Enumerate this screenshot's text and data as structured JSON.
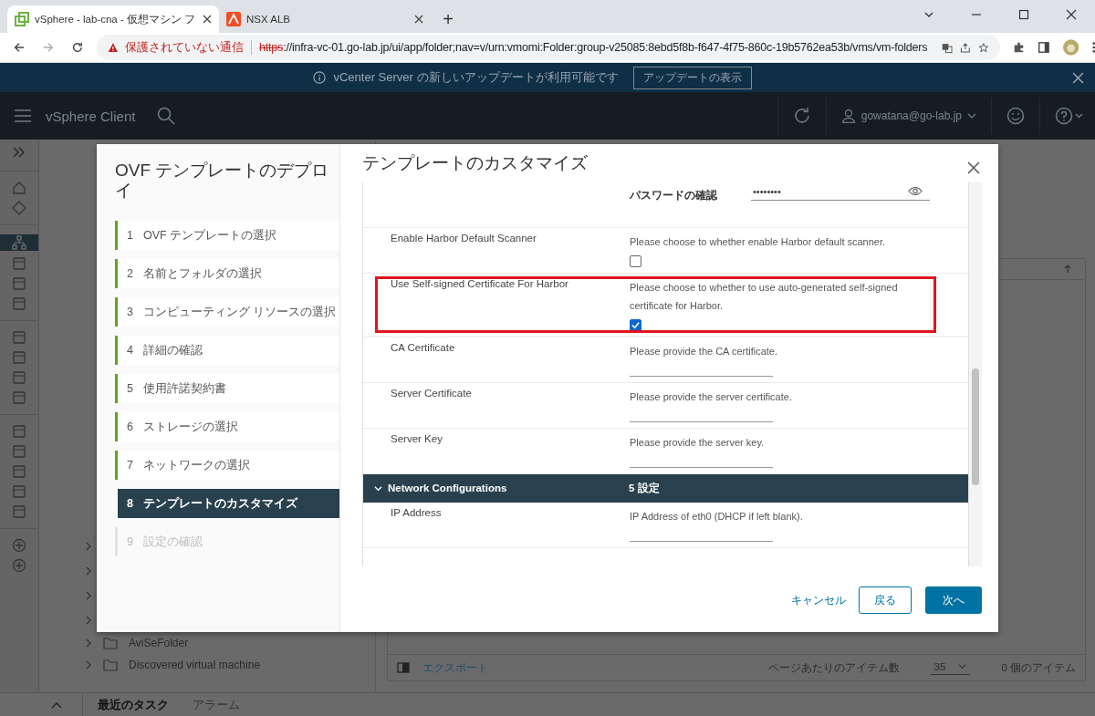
{
  "browser": {
    "tabs": [
      {
        "title": "vSphere - lab-cna - 仮想マシン フ",
        "selected": true
      },
      {
        "title": "NSX ALB",
        "selected": false
      }
    ],
    "new_tab": "+",
    "security_label": "保護されていない通信",
    "url_scheme": "https",
    "url": "://infra-vc-01.go-lab.jp/ui/app/folder;nav=v/urn:vmomi:Folder:group-v25085:8ebd5f8b-f647-4f75-860c-19b5762ea53b/vms/vm-folders"
  },
  "banner": {
    "message": "vCenter Server の新しいアップデートが利用可能です",
    "button": "アップデートの表示"
  },
  "header": {
    "app_name": "vSphere Client",
    "user": "gowatana@go-lab.jp"
  },
  "inventory": {
    "folders": [
      {
        "name": "AviSeFolder"
      },
      {
        "name": "Discovered virtual machine"
      }
    ]
  },
  "table_footer": {
    "export": "エクスポート",
    "page_size_label": "ページあたりのアイテム数",
    "page_size": "35",
    "item_count": "0 個のアイテム"
  },
  "bottom_tabs": [
    {
      "label": "最近のタスク",
      "selected": true
    },
    {
      "label": "アラーム",
      "selected": false
    }
  ],
  "dialog": {
    "title": "OVF テンプレートのデプロイ",
    "steps": [
      {
        "number": "1",
        "label": "OVF テンプレートの選択",
        "completed": true,
        "selected": false,
        "disabled": false
      },
      {
        "number": "2",
        "label": "名前とフォルダの選択",
        "completed": true,
        "selected": false,
        "disabled": false
      },
      {
        "number": "3",
        "label": "コンピューティング リソースの選択",
        "completed": true,
        "selected": false,
        "disabled": false
      },
      {
        "number": "4",
        "label": "詳細の確認",
        "completed": true,
        "selected": false,
        "disabled": false
      },
      {
        "number": "5",
        "label": "使用許諾契約書",
        "completed": true,
        "selected": false,
        "disabled": false
      },
      {
        "number": "6",
        "label": "ストレージの選択",
        "completed": true,
        "selected": false,
        "disabled": false
      },
      {
        "number": "7",
        "label": "ネットワークの選択",
        "completed": true,
        "selected": false,
        "disabled": false
      },
      {
        "number": "8",
        "label": "テンプレートのカスタマイズ",
        "completed": false,
        "selected": true,
        "disabled": false
      },
      {
        "number": "9",
        "label": "設定の確認",
        "completed": false,
        "selected": false,
        "disabled": true
      }
    ],
    "section_title": "テンプレートのカスタマイズ",
    "properties": [
      {
        "kind": "password",
        "label": "パスワードの確認",
        "value": "••••••••"
      },
      {
        "kind": "checkbox",
        "name": "Enable Harbor Default Scanner",
        "description": "Please choose to whether enable Harbor default scanner.",
        "checked": false,
        "highlighted": false
      },
      {
        "kind": "checkbox",
        "name": "Use Self-signed Certificate For Harbor",
        "description": "Please choose to whether to use auto-generated self-signed certificate for Harbor.",
        "checked": true,
        "highlighted": true
      },
      {
        "kind": "text",
        "name": "CA Certificate",
        "description": "Please provide the CA certificate."
      },
      {
        "kind": "text",
        "name": "Server Certificate",
        "description": "Please provide the server certificate."
      },
      {
        "kind": "text",
        "name": "Server Key",
        "description": "Please provide the server key."
      },
      {
        "kind": "group",
        "name": "Network Configurations",
        "count": "5 設定",
        "expanded": true
      },
      {
        "kind": "text",
        "name": "IP Address",
        "description": "IP Address of eth0 (DHCP if left blank)."
      }
    ],
    "buttons": {
      "cancel": "キャンセル",
      "back": "戻る",
      "next": "次へ"
    }
  }
}
